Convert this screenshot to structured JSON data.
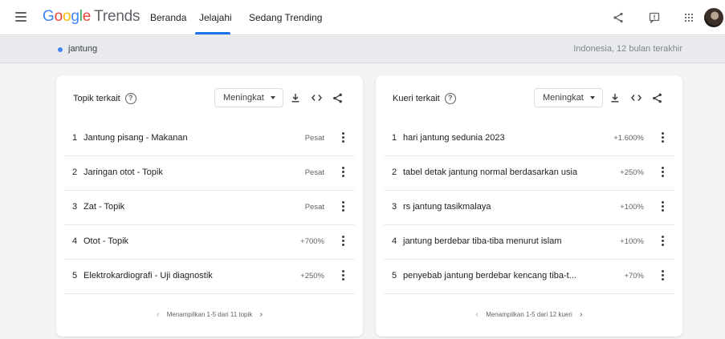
{
  "header": {
    "logo_google": [
      "G",
      "o",
      "o",
      "g",
      "l",
      "e"
    ],
    "logo_trends": "Trends",
    "nav": [
      {
        "label": "Beranda",
        "active": false
      },
      {
        "label": "Jelajahi",
        "active": true
      },
      {
        "label": "Sedang Trending",
        "active": false
      }
    ],
    "icons": [
      "share-icon",
      "feedback-icon",
      "apps-grid-icon",
      "avatar"
    ]
  },
  "subbar": {
    "term": "jantung",
    "region_period": "Indonesia, 12 bulan terakhir"
  },
  "topics": {
    "title": "Topik terkait",
    "help": "?",
    "filter": "Meningkat",
    "rows": [
      {
        "num": "1",
        "label": "Jantung pisang - Makanan",
        "value": "Pesat"
      },
      {
        "num": "2",
        "label": "Jaringan otot - Topik",
        "value": "Pesat"
      },
      {
        "num": "3",
        "label": "Zat - Topik",
        "value": "Pesat"
      },
      {
        "num": "4",
        "label": "Otot - Topik",
        "value": "+700%"
      },
      {
        "num": "5",
        "label": "Elektrokardiografi - Uji diagnostik",
        "value": "+250%"
      }
    ],
    "pager": "Menampilkan 1-5 dari 11 topik"
  },
  "queries": {
    "title": "Kueri terkait",
    "help": "?",
    "filter": "Meningkat",
    "rows": [
      {
        "num": "1",
        "label": "hari jantung sedunia 2023",
        "value": "+1.600%"
      },
      {
        "num": "2",
        "label": "tabel detak jantung normal berdasarkan usia",
        "value": "+250%"
      },
      {
        "num": "3",
        "label": "rs jantung tasikmalaya",
        "value": "+100%"
      },
      {
        "num": "4",
        "label": "jantung berdebar tiba-tiba menurut islam",
        "value": "+100%"
      },
      {
        "num": "5",
        "label": "penyebab jantung berdebar kencang tiba-t...",
        "value": "+70%"
      }
    ],
    "pager": "Menampilkan 1-5 dari 12 kueri"
  },
  "colors": {
    "accent": "#1a73e8",
    "term_dot": "#4285f4"
  }
}
